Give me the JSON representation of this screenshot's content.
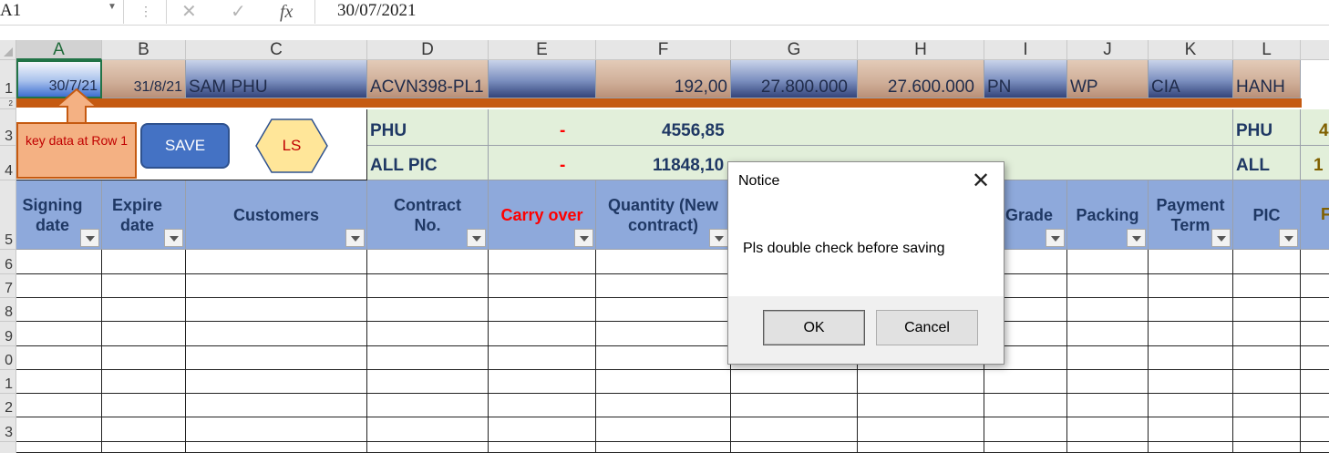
{
  "formula_bar": {
    "name_box": "A1",
    "separator": "⋮",
    "cancel_icon": "✕",
    "enter_icon": "✓",
    "fx_label": "fx",
    "formula_value": "30/07/2021"
  },
  "columns": [
    "A",
    "B",
    "C",
    "D",
    "E",
    "F",
    "G",
    "H",
    "I",
    "J",
    "K",
    "L"
  ],
  "row_numbers": [
    "1",
    "2",
    "3",
    "4",
    "5",
    "6",
    "7",
    "8",
    "9",
    "0",
    "1",
    "2",
    "3"
  ],
  "row1": {
    "signing_date": "30/7/21",
    "expire_date": "31/8/21",
    "customer": "SAM PHU",
    "contract_no": "ACVN398-PL1",
    "carry_over": "",
    "quantity": "192,00",
    "g_value": "27.800.000",
    "h_value": "27.600.000",
    "grade": "PN",
    "packing": "WP",
    "payment_term": "CIA",
    "pic": "HANH"
  },
  "summary": {
    "row3": {
      "label": "PHU",
      "dash": "-",
      "value": "4556,85",
      "right_label": "PHU",
      "right_value": "4"
    },
    "row4": {
      "label": "ALL PIC",
      "dash": "-",
      "value": "11848,10",
      "right_label": "ALL",
      "right_value": "1"
    }
  },
  "shapes": {
    "note": "key data at Row 1",
    "save": "SAVE",
    "ls": "LS"
  },
  "headers": {
    "signing_date": "Signing date",
    "expire_date": "Expire date",
    "customers": "Customers",
    "contract_no": "Contract No.",
    "carry_over": "Carry over",
    "quantity": "Quantity (New contract)",
    "grade": "Grade",
    "packing": "Packing",
    "payment_term": "Payment Term",
    "pic": "PIC",
    "m_partial": "F"
  },
  "dialog": {
    "title": "Notice",
    "close_icon": "✕",
    "message": "Pls double check before saving",
    "ok": "OK",
    "cancel": "Cancel"
  },
  "colors": {
    "accent_green": "#217346",
    "header_blue": "#8ea9db",
    "summary_green": "#e2efda",
    "orange_bar": "#c55a11",
    "save_blue": "#4472c4",
    "ls_yellow": "#ffe699"
  }
}
